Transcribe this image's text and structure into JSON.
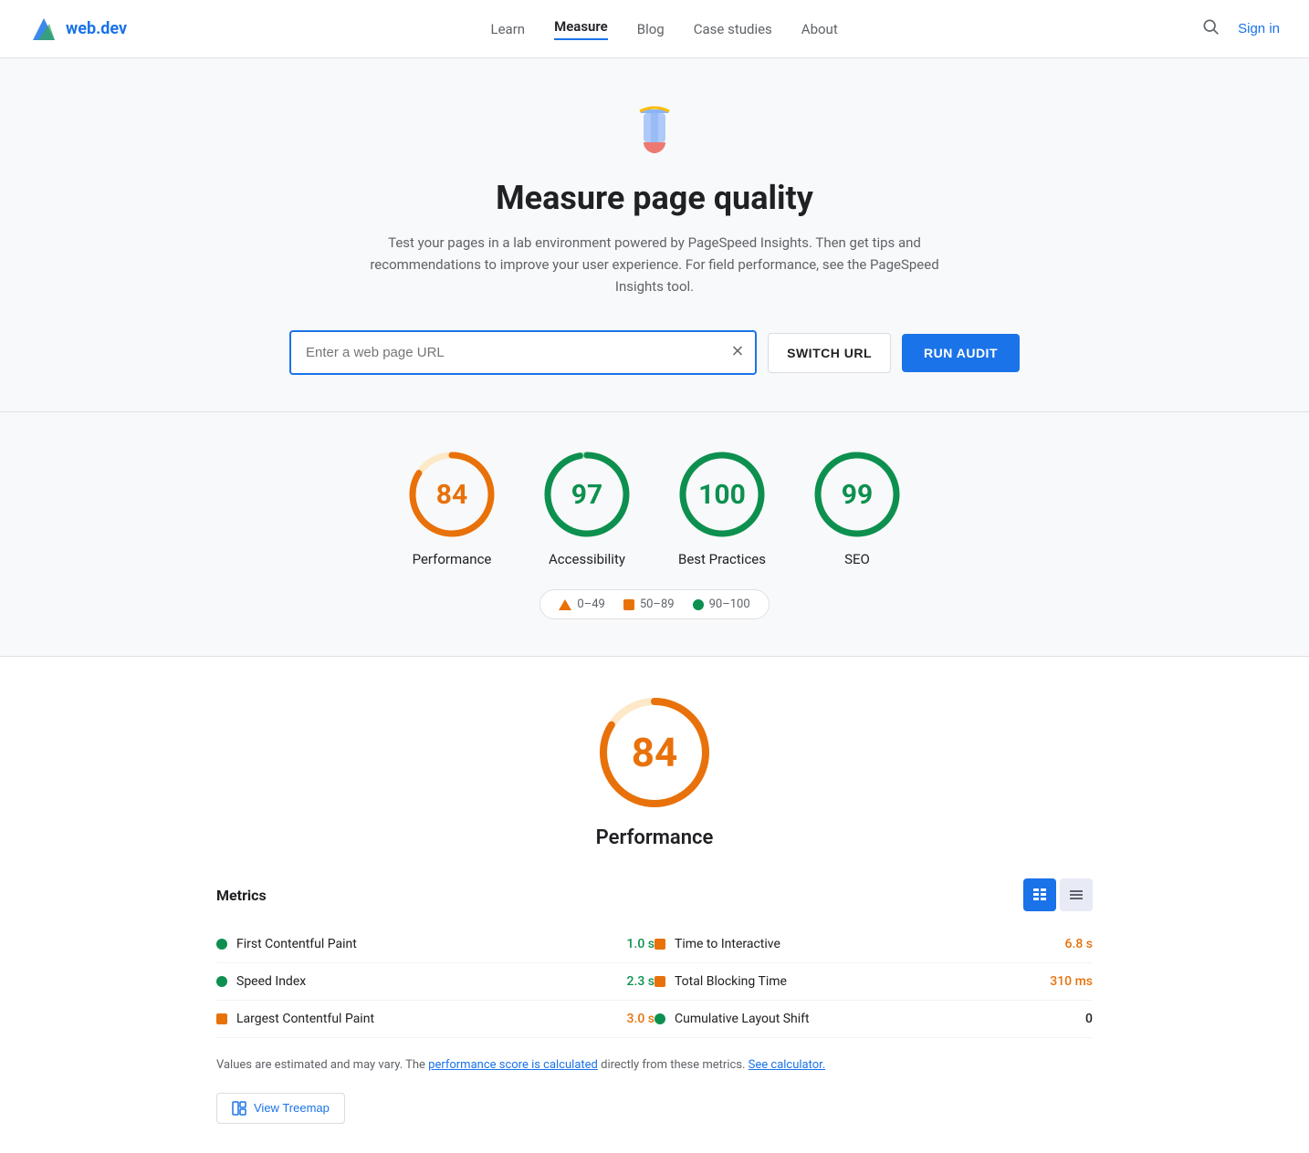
{
  "nav": {
    "logo_text": "web.dev",
    "links": [
      {
        "label": "Learn",
        "active": false
      },
      {
        "label": "Measure",
        "active": true
      },
      {
        "label": "Blog",
        "active": false
      },
      {
        "label": "Case studies",
        "active": false
      },
      {
        "label": "About",
        "active": false
      }
    ],
    "signin_label": "Sign in"
  },
  "hero": {
    "title": "Measure page quality",
    "description": "Test your pages in a lab environment powered by PageSpeed Insights. Then get tips and recommendations to improve your user experience. For field performance, see the PageSpeed Insights tool."
  },
  "url_input": {
    "placeholder": "Enter a web page URL",
    "value": "",
    "switch_url_label": "SWITCH URL",
    "run_audit_label": "RUN AUDIT"
  },
  "scores": [
    {
      "id": "performance",
      "value": 84,
      "label": "Performance",
      "color": "#e8710a",
      "bg_color": "#fef3e2",
      "ring_color": "#e8710a",
      "track_color": "#fde8c8"
    },
    {
      "id": "accessibility",
      "value": 97,
      "label": "Accessibility",
      "color": "#0d904f",
      "bg_color": "#e6f4ea",
      "ring_color": "#0d904f",
      "track_color": "#c8e6c9"
    },
    {
      "id": "best-practices",
      "value": 100,
      "label": "Best Practices",
      "color": "#0d904f",
      "bg_color": "#e6f4ea",
      "ring_color": "#0d904f",
      "track_color": "#c8e6c9"
    },
    {
      "id": "seo",
      "value": 99,
      "label": "SEO",
      "color": "#0d904f",
      "bg_color": "#e6f4ea",
      "ring_color": "#0d904f",
      "track_color": "#c8e6c9"
    }
  ],
  "legend": [
    {
      "type": "triangle",
      "range": "0–49",
      "color": "#e8710a"
    },
    {
      "type": "square",
      "range": "50–89",
      "color": "#e8710a"
    },
    {
      "type": "dot",
      "range": "90–100",
      "color": "#0d904f"
    }
  ],
  "performance_detail": {
    "score": 84,
    "title": "Performance",
    "metrics_title": "Metrics",
    "metrics": [
      {
        "id": "fcp",
        "indicator": "dot",
        "color": "#0d904f",
        "name": "First Contentful Paint",
        "value": "1.0 s",
        "value_color": "green"
      },
      {
        "id": "speed-index",
        "indicator": "dot",
        "color": "#0d904f",
        "name": "Speed Index",
        "value": "2.3 s",
        "value_color": "green"
      },
      {
        "id": "lcp",
        "indicator": "square",
        "color": "#e8710a",
        "name": "Largest Contentful Paint",
        "value": "3.0 s",
        "value_color": "orange"
      },
      {
        "id": "tti",
        "indicator": "square",
        "color": "#e8710a",
        "name": "Time to Interactive",
        "value": "6.8 s",
        "value_color": "orange"
      },
      {
        "id": "tbt",
        "indicator": "square",
        "color": "#e8710a",
        "name": "Total Blocking Time",
        "value": "310 ms",
        "value_color": "orange"
      },
      {
        "id": "cls",
        "indicator": "dot",
        "color": "#0d904f",
        "name": "Cumulative Layout Shift",
        "value": "0",
        "value_color": "neutral"
      }
    ],
    "values_note": "Values are estimated and may vary. The ",
    "perf_score_link": "performance score is calculated",
    "values_note_2": " directly from these metrics. ",
    "calculator_link": "See calculator.",
    "view_treemap_label": "View Treemap"
  }
}
